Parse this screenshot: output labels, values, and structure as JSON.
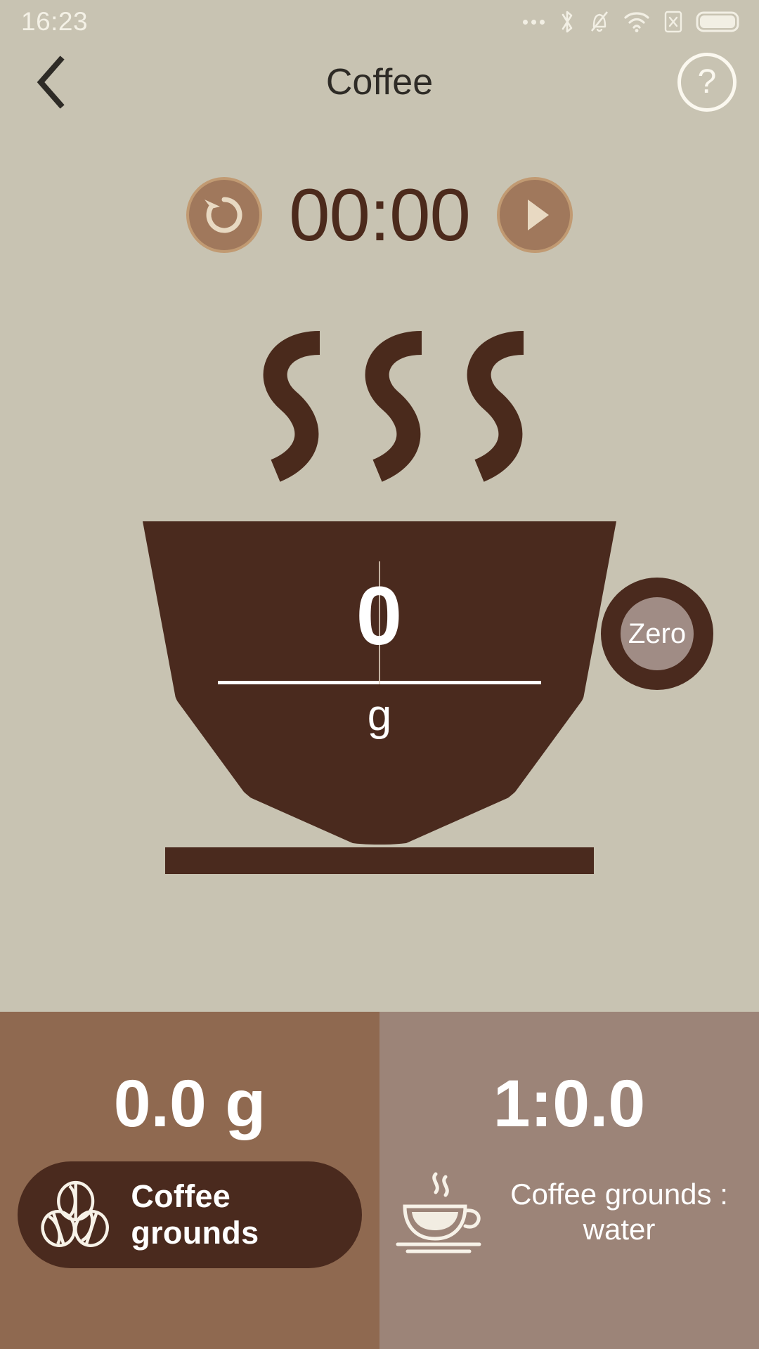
{
  "status_bar": {
    "time": "16:23",
    "icons": [
      "more-dots",
      "bluetooth",
      "mute-bell",
      "wifi",
      "sim-x",
      "battery"
    ]
  },
  "header": {
    "title": "Coffee",
    "back_icon": "chevron-left",
    "help_icon": "question-mark",
    "help_label": "?"
  },
  "timer": {
    "value": "00:00",
    "reset_icon": "reset-arrow",
    "play_icon": "play-triangle"
  },
  "scale": {
    "value": "0",
    "unit": "g",
    "zero_label": "Zero",
    "cup_icon": "coffee-cup",
    "steam_icon": "steam-swirls"
  },
  "bottom": {
    "left": {
      "value": "0.0 g",
      "pill_label": "Coffee grounds",
      "pill_icon": "coffee-beans"
    },
    "right": {
      "value": "1:0.0",
      "label_line1": "Coffee grounds :",
      "label_line2": "water",
      "icon": "coffee-cup-saucer"
    }
  },
  "colors": {
    "background": "#c8c3b2",
    "dark_brown": "#4a2a1e",
    "mid_brown": "#a0785c",
    "panel_left": "#8f6950",
    "panel_right": "#9c8478",
    "zero_inner": "#a08c85",
    "white": "#ffffff"
  }
}
